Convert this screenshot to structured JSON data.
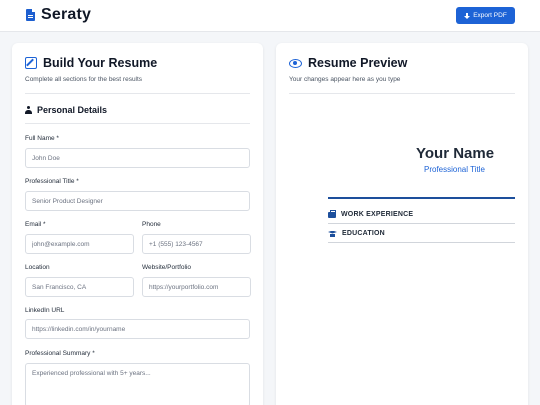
{
  "app": {
    "name": "Seraty",
    "export_label": "Export PDF"
  },
  "builder": {
    "title": "Build Your Resume",
    "subtitle": "Complete all sections for the best results",
    "section_title": "Personal Details",
    "fields": {
      "full_name": {
        "label": "Full Name *",
        "placeholder": "John Doe"
      },
      "professional_title": {
        "label": "Professional Title *",
        "placeholder": "Senior Product Designer"
      },
      "email": {
        "label": "Email *",
        "placeholder": "john@example.com"
      },
      "phone": {
        "label": "Phone",
        "placeholder": "+1 (555) 123-4567"
      },
      "location": {
        "label": "Location",
        "placeholder": "San Francisco, CA"
      },
      "website": {
        "label": "Website/Portfolio",
        "placeholder": "https://yourportfolio.com"
      },
      "linkedin": {
        "label": "LinkedIn URL",
        "placeholder": "https://linkedin.com/in/yourname"
      },
      "summary": {
        "label": "Professional Summary *",
        "placeholder": "Experienced professional with 5+ years..."
      }
    }
  },
  "preview": {
    "title": "Resume Preview",
    "subtitle": "Your changes appear here as you type",
    "name": "Your Name",
    "role": "Professional Title",
    "sections": [
      "WORK EXPERIENCE",
      "EDUCATION"
    ]
  },
  "colors": {
    "accent": "#1d63d6",
    "rule": "#1d4f9c",
    "background": "#f4f6f9"
  }
}
